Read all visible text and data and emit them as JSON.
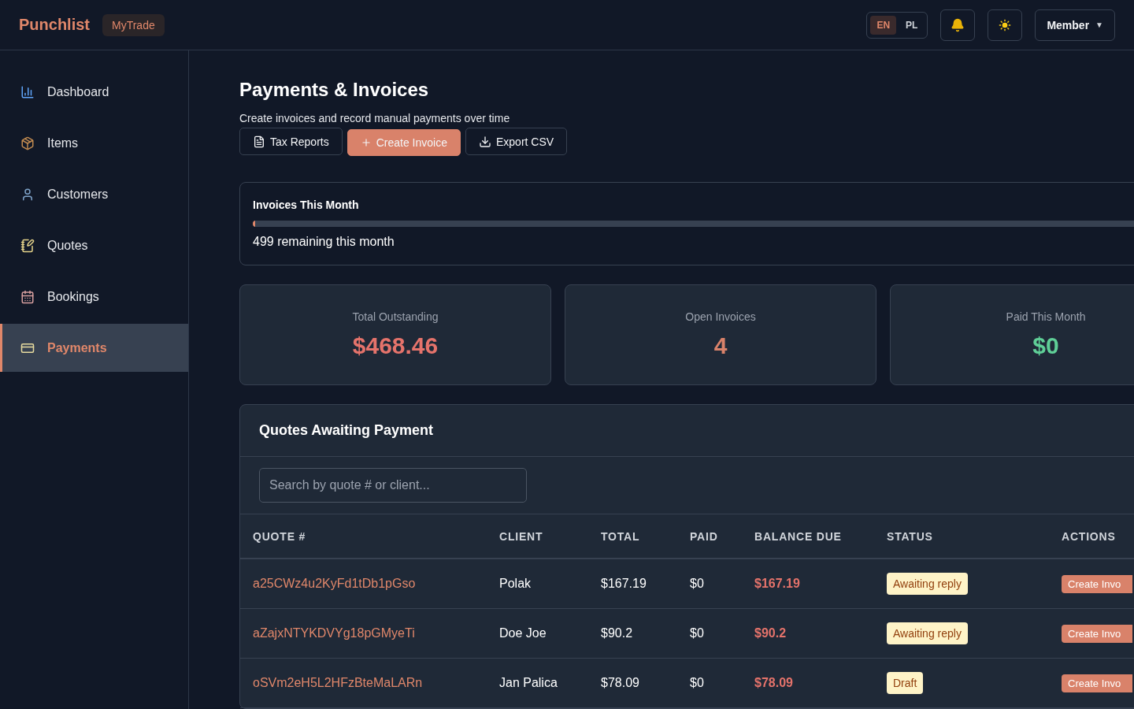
{
  "brand": {
    "name": "Punchlist",
    "workspace": "MyTrade"
  },
  "languages": [
    {
      "label": "EN",
      "selected": true
    },
    {
      "label": "PL",
      "selected": false
    }
  ],
  "user_menu": {
    "label": "Member",
    "caret": "▼"
  },
  "sidebar": {
    "items": [
      {
        "label": "Dashboard",
        "kind": "chart",
        "selected": false
      },
      {
        "label": "Items",
        "kind": "package",
        "selected": false
      },
      {
        "label": "Customers",
        "kind": "user",
        "selected": false
      },
      {
        "label": "Quotes",
        "kind": "notepad",
        "selected": false
      },
      {
        "label": "Bookings",
        "kind": "calendar",
        "selected": false
      },
      {
        "label": "Payments",
        "kind": "card",
        "selected": true
      }
    ]
  },
  "page": {
    "title": "Payments & Invoices",
    "subtitle": "Create invoices and record manual payments over time"
  },
  "actions": [
    {
      "label": "Tax Reports",
      "kind": "report"
    },
    {
      "label": "Create Invoice",
      "kind": "create"
    },
    {
      "label": "Export CSV",
      "kind": "export"
    }
  ],
  "usage": {
    "title": "Invoices This Month",
    "level": 0.002,
    "reading": "499 remaining this month"
  },
  "stats": [
    {
      "label": "Total Outstanding",
      "value": "$468.46",
      "color": "#e5736b"
    },
    {
      "label": "Open Invoices",
      "value": "4",
      "color": "#d9826a"
    },
    {
      "label": "Paid This Month",
      "value": "$0",
      "color": "#5fcf97"
    }
  ],
  "quotes": {
    "title": "Quotes Awaiting Payment",
    "search": {
      "placeholder": "Search by quote # or client..."
    },
    "columns": [
      "QUOTE #",
      "CLIENT",
      "TOTAL",
      "PAID",
      "BALANCE DUE",
      "STATUS",
      "ACTIONS"
    ],
    "rows": [
      {
        "quote": "a25CWz4u2KyFd1tDb1pGso",
        "client": "Polak",
        "total": "$167.19",
        "paid": "$0",
        "balance": "$167.19",
        "status": "Awaiting reply",
        "action": "Create Invo"
      },
      {
        "quote": "aZajxNTYKDVYg18pGMyeTi",
        "client": "Doe Joe",
        "total": "$90.2",
        "paid": "$0",
        "balance": "$90.2",
        "status": "Awaiting reply",
        "action": "Create Invo"
      },
      {
        "quote": "oSVm2eH5L2HFzBteMaLARn",
        "client": "Jan Palica",
        "total": "$78.09",
        "paid": "$0",
        "balance": "$78.09",
        "status": "Draft",
        "action": "Create Invo"
      }
    ]
  }
}
